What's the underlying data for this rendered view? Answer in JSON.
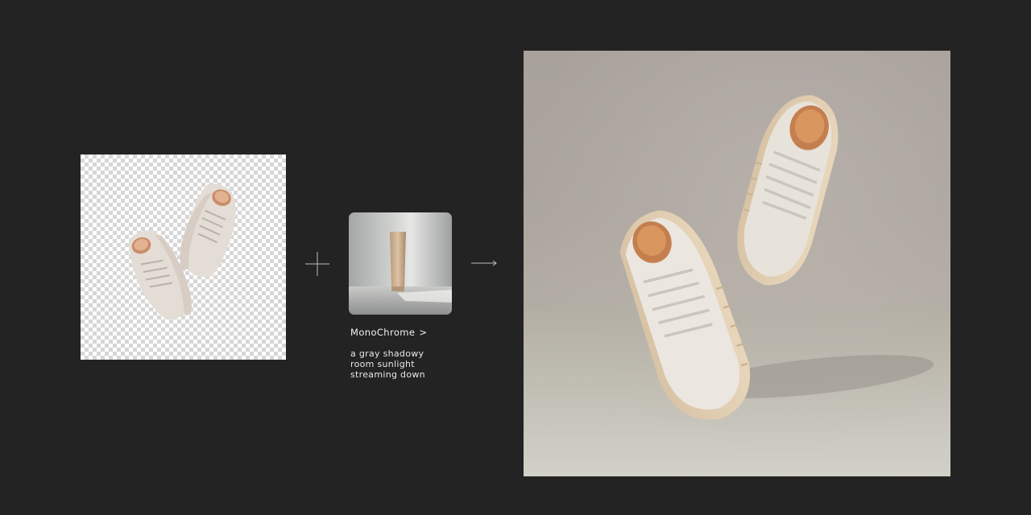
{
  "input": {
    "subject_icon": "sneaker-pair-icon",
    "background": "transparent-checkerboard"
  },
  "connectors": {
    "plus_icon": "plus-icon",
    "arrow_icon": "arrow-right-icon"
  },
  "style": {
    "thumbnail_icon": "product-tube-icon",
    "name": "MonoChrome",
    "chevron": ">",
    "prompt_lines": [
      "a gray shadowy",
      "room sunlight",
      "streaming down"
    ]
  },
  "output": {
    "subject_icon": "sneaker-pair-icon"
  },
  "colors": {
    "page_background": "#232323",
    "text": "#ffffff",
    "shoe_leather": "#e8e2da",
    "shoe_sole": "#dcc6a6",
    "shoe_lining": "#d08f5e"
  }
}
